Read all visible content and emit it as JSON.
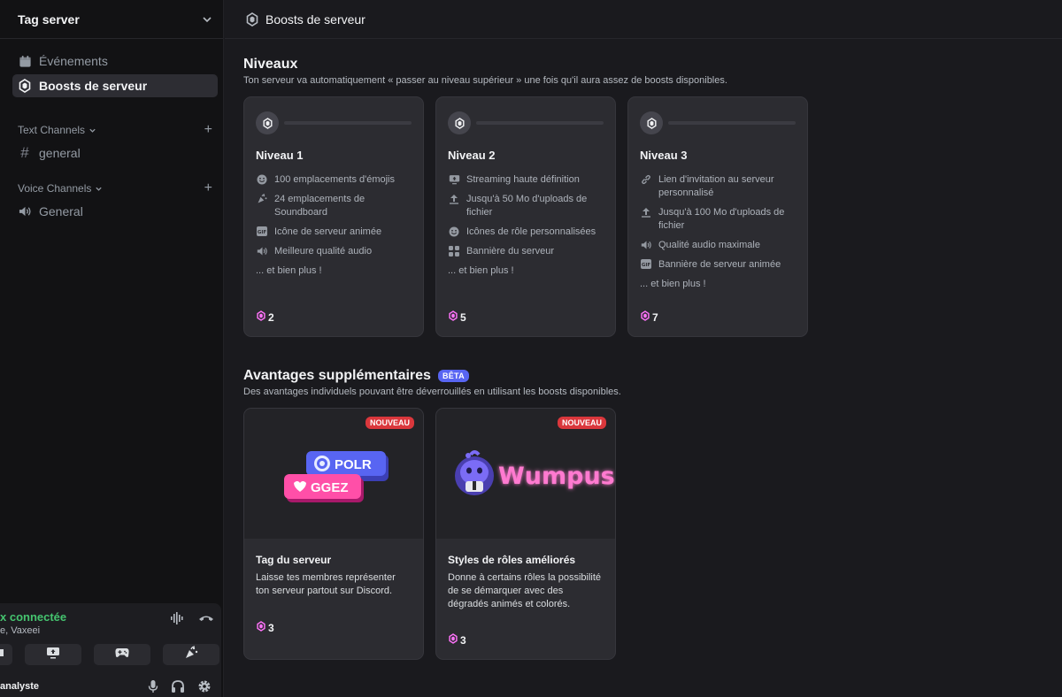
{
  "sidebar": {
    "server_name": "Tag server",
    "nav": [
      {
        "label": "Événements",
        "icon": "calendar-icon"
      },
      {
        "label": "Boosts de serveur",
        "icon": "boost-gem-icon"
      }
    ],
    "categories": [
      {
        "label": "Text Channels",
        "channels": [
          {
            "label": "general",
            "icon": "hash-icon"
          }
        ]
      },
      {
        "label": "Voice Channels",
        "channels": [
          {
            "label": "General",
            "icon": "speaker-icon"
          }
        ]
      }
    ],
    "voice": {
      "status": "x connectée",
      "channel": "e, Vaxeei"
    },
    "user": {
      "name": "analyste"
    }
  },
  "header": {
    "title": "Boosts de serveur"
  },
  "levels": {
    "title": "Niveaux",
    "subtitle": "Ton serveur va automatiquement « passer au niveau supérieur » une fois qu'il aura assez de boosts disponibles.",
    "tiers": [
      {
        "name": "Niveau 1",
        "perks": [
          {
            "icon": "emoji-icon",
            "label": "100 emplacements d'émojis"
          },
          {
            "icon": "soundboard-icon",
            "label": "24 emplacements de Soundboard"
          },
          {
            "icon": "gif-icon",
            "label": "Icône de serveur animée"
          },
          {
            "icon": "speaker-icon",
            "label": "Meilleure qualité audio"
          }
        ],
        "more": "... et bien plus !",
        "cost": "2"
      },
      {
        "name": "Niveau 2",
        "perks": [
          {
            "icon": "stream-icon",
            "label": "Streaming haute définition"
          },
          {
            "icon": "upload-icon",
            "label": "Jusqu'à 50 Mo d'uploads de fichier"
          },
          {
            "icon": "emoji-icon",
            "label": "Icônes de rôle personnalisées"
          },
          {
            "icon": "banner-icon",
            "label": "Bannière du serveur"
          }
        ],
        "more": "... et bien plus !",
        "cost": "5"
      },
      {
        "name": "Niveau 3",
        "perks": [
          {
            "icon": "link-icon",
            "label": "Lien d'invitation au serveur personnalisé"
          },
          {
            "icon": "upload-icon",
            "label": "Jusqu'à 100 Mo d'uploads de fichier"
          },
          {
            "icon": "speaker-icon",
            "label": "Qualité audio maximale"
          },
          {
            "icon": "gif-icon",
            "label": "Bannière de serveur animée"
          }
        ],
        "more": "... et bien plus !",
        "cost": "7"
      }
    ]
  },
  "extras": {
    "title": "Avantages supplémentaires",
    "beta": "BÊTA",
    "subtitle": "Des avantages individuels pouvant être déverrouillés en utilisant les boosts disponibles.",
    "cards": [
      {
        "badge": "NOUVEAU",
        "title": "Tag du serveur",
        "desc": "Laisse tes membres représenter ton serveur partout sur Discord.",
        "cost": "3",
        "tags": [
          "POLR",
          "GGEZ"
        ]
      },
      {
        "badge": "NOUVEAU",
        "title": "Styles de rôles améliorés",
        "desc": "Donne à certains rôles la possibilité de se démarquer avec des dégradés animés et colorés.",
        "cost": "3",
        "wordmark": "Wumpus"
      }
    ]
  },
  "colors": {
    "boost_pink": "#ff73fa",
    "voice_green": "#45c46f",
    "beta_blue": "#5865f2",
    "new_red": "#da373c"
  }
}
